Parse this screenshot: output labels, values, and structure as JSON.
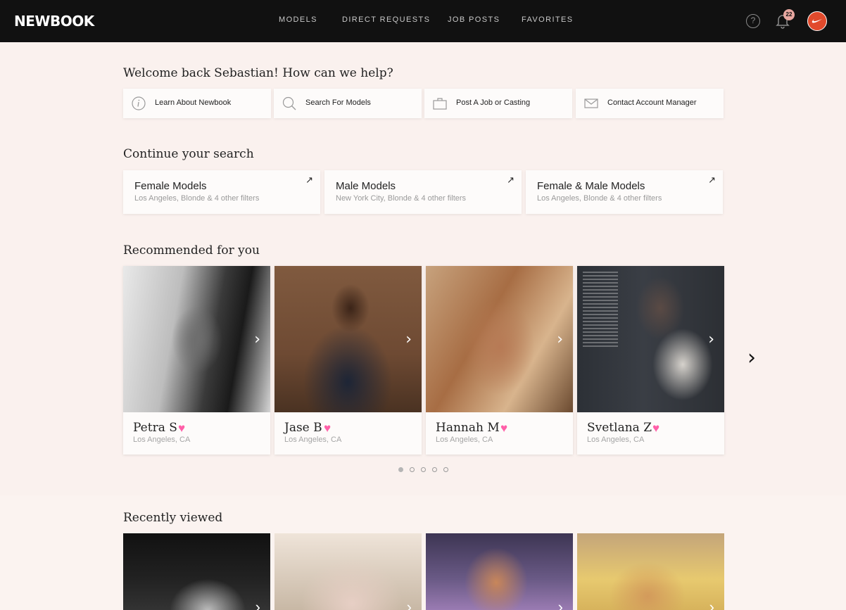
{
  "nav": {
    "logo": "NEWBOOK",
    "items": [
      "MODELS",
      "DIRECT REQUESTS",
      "JOB POSTS",
      "FAVORITES"
    ],
    "notification_count": "22",
    "help_symbol": "?"
  },
  "welcome": {
    "title": "Welcome back Sebastian! How can we help?",
    "actions": [
      {
        "label": "Learn About Newbook",
        "icon": "info-icon"
      },
      {
        "label": "Search For Models",
        "icon": "search-icon"
      },
      {
        "label": "Post A Job or Casting",
        "icon": "briefcase-icon"
      },
      {
        "label": "Contact Account Manager",
        "icon": "mail-icon"
      }
    ]
  },
  "continue_search": {
    "title": "Continue your search",
    "items": [
      {
        "title": "Female Models",
        "subtitle": "Los Angeles, Blonde & 4 other filters"
      },
      {
        "title": "Male Models",
        "subtitle": "New York City, Blonde & 4 other filters"
      },
      {
        "title": "Female & Male Models",
        "subtitle": "Los Angeles, Blonde & 4 other filters"
      }
    ],
    "arrow_symbol": "↗"
  },
  "recommended": {
    "title": "Recommended for you",
    "models": [
      {
        "name": "Petra S",
        "location": "Los Angeles, CA"
      },
      {
        "name": "Jase B",
        "location": "Los Angeles, CA"
      },
      {
        "name": "Hannah M",
        "location": "Los Angeles, CA"
      },
      {
        "name": "Svetlana Z",
        "location": "Los Angeles, CA"
      }
    ],
    "heart_symbol": "♥",
    "chevron_symbol": "›",
    "next_symbol": "›",
    "page_count": 5,
    "active_page": 1
  },
  "recent": {
    "title": "Recently viewed"
  },
  "colors": {
    "topbar": "#111111",
    "background": "#faf1ee",
    "heart": "#ff5fa8",
    "avatar": "#e14a2c"
  }
}
